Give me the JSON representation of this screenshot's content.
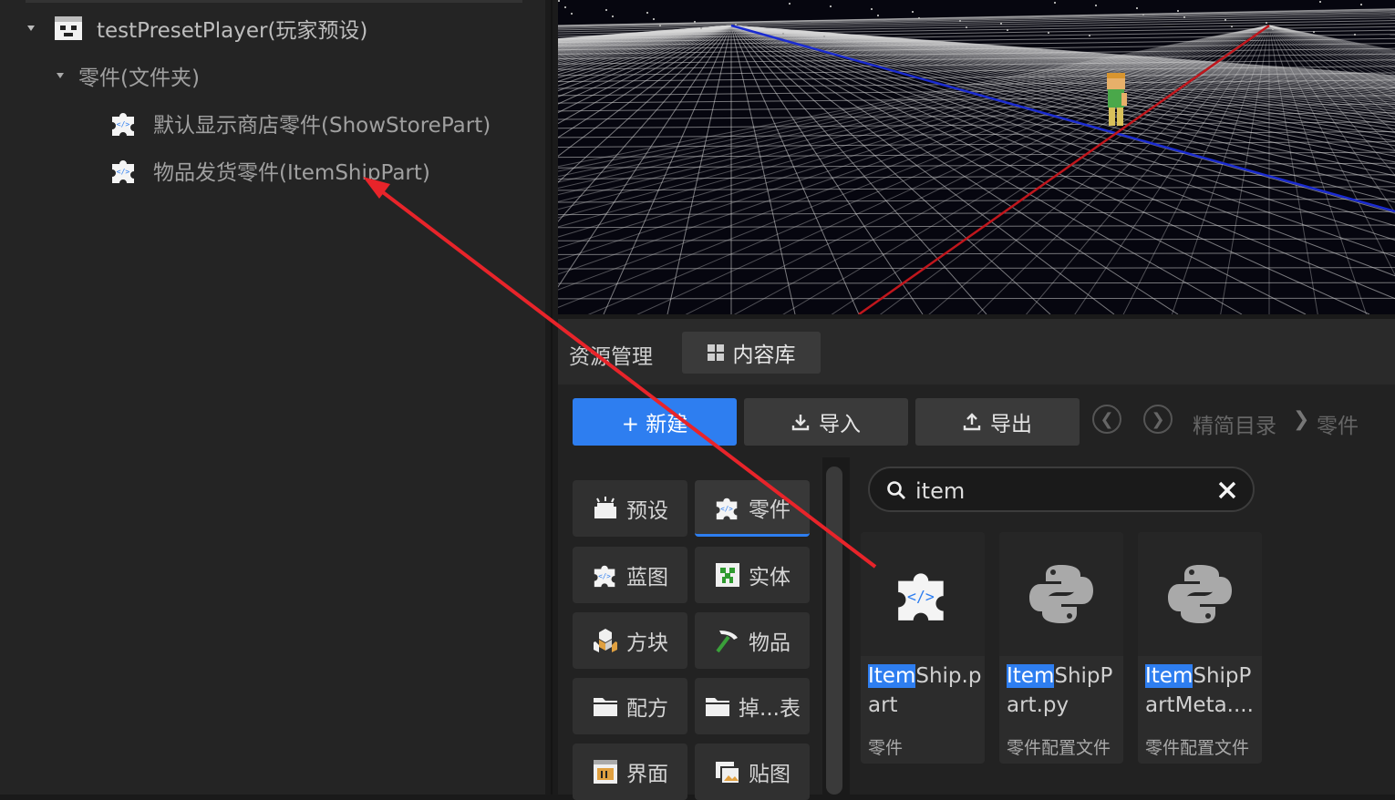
{
  "tree": {
    "root_label": "testPresetPlayer(玩家预设)",
    "folder_label": "零件(文件夹)",
    "items": [
      {
        "label": "默认显示商店零件(ShowStorePart)"
      },
      {
        "label": "物品发货零件(ItemShipPart)"
      }
    ]
  },
  "panel": {
    "title": "资源管理",
    "tab_label": "内容库"
  },
  "toolbar": {
    "new_label": "+ 新建",
    "import_label": "导入",
    "export_label": "导出",
    "breadcrumb": [
      "精简目录",
      "零件"
    ]
  },
  "categories": [
    {
      "label": "预设",
      "icon": "preset-icon",
      "active": false
    },
    {
      "label": "零件",
      "icon": "part-icon",
      "active": true
    },
    {
      "label": "蓝图",
      "icon": "blueprint-icon",
      "active": false
    },
    {
      "label": "实体",
      "icon": "entity-icon",
      "active": false
    },
    {
      "label": "方块",
      "icon": "block-icon",
      "active": false
    },
    {
      "label": "物品",
      "icon": "item-icon",
      "active": false
    },
    {
      "label": "配方",
      "icon": "folder-icon",
      "active": false
    },
    {
      "label": "掉...表",
      "icon": "folder-icon",
      "active": false
    },
    {
      "label": "界面",
      "icon": "ui-icon",
      "active": false
    },
    {
      "label": "贴图",
      "icon": "texture-icon",
      "active": false
    }
  ],
  "search": {
    "value": "item"
  },
  "results": [
    {
      "highlight": "Item",
      "rest": "Ship.part",
      "type": "零件",
      "icon": "part-icon"
    },
    {
      "highlight": "Item",
      "rest": "ShipPart.py",
      "type": "零件配置文件",
      "icon": "python-icon"
    },
    {
      "highlight": "Item",
      "rest": "ShipPartMeta....",
      "type": "零件配置文件",
      "icon": "python-icon"
    }
  ],
  "colors": {
    "accent": "#2e7ef0",
    "annotation_arrow": "#e8242a",
    "x_axis": "#c0161c",
    "z_axis": "#1a2bd0"
  }
}
